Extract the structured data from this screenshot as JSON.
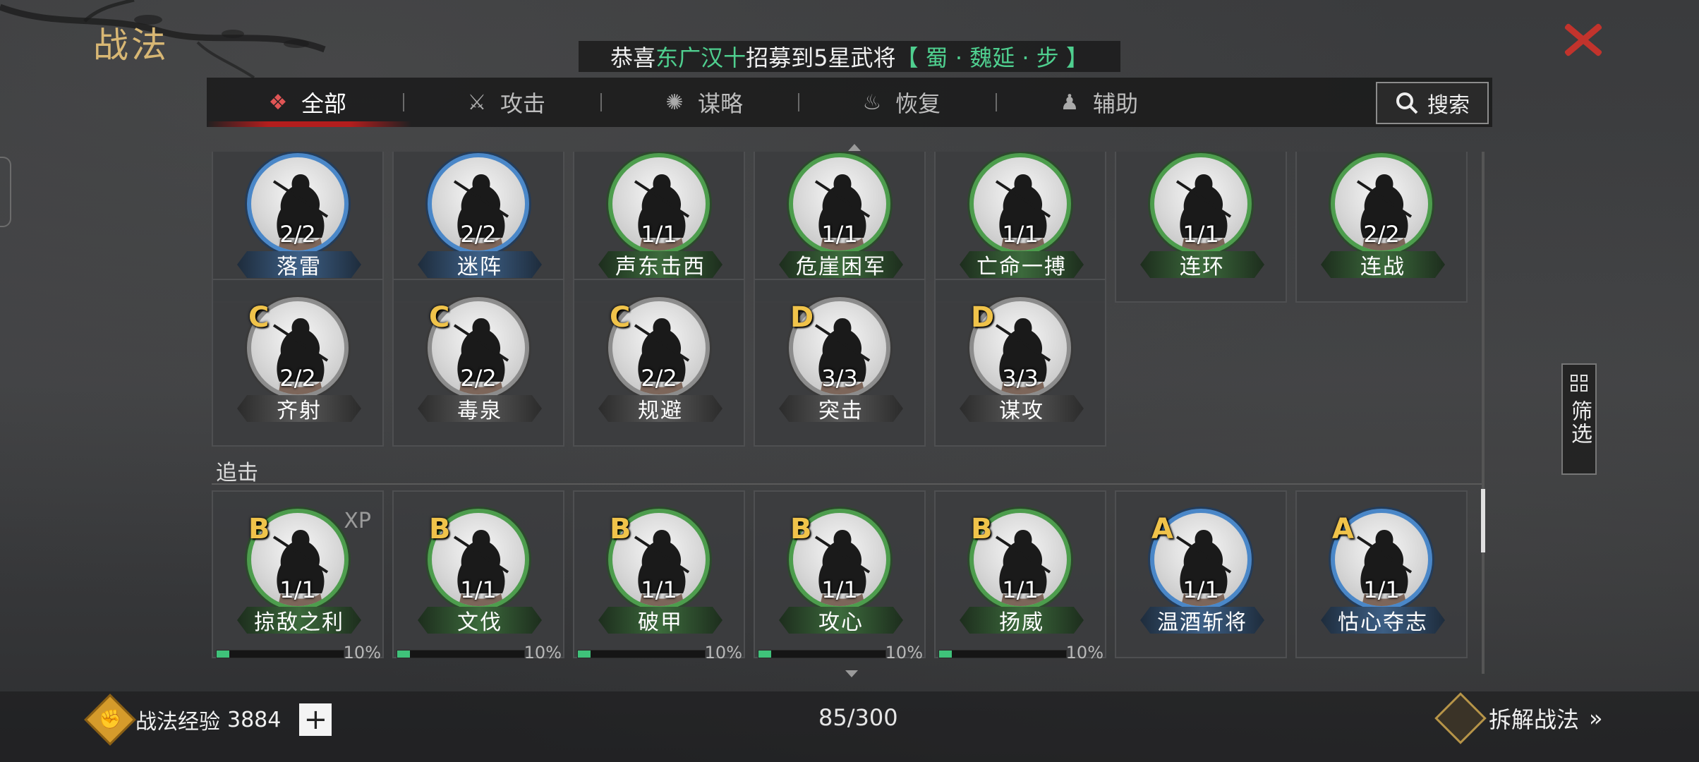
{
  "header": {
    "title": "战法",
    "close_icon": "close-x-icon"
  },
  "banner": {
    "prefix": "恭喜",
    "player": "东广汉十",
    "middle": "招募到5星武将",
    "general": "【 蜀 · 魏延 · 步 】"
  },
  "tabs": [
    {
      "label": "全部",
      "icon": "scroll-bundle-icon",
      "active": true
    },
    {
      "label": "攻击",
      "icon": "crossed-swords-icon",
      "active": false
    },
    {
      "label": "谋略",
      "icon": "fan-icon",
      "active": false
    },
    {
      "label": "恢复",
      "icon": "pot-icon",
      "active": false
    },
    {
      "label": "辅助",
      "icon": "pouch-icon",
      "active": false
    }
  ],
  "search": {
    "label": "搜索"
  },
  "rows": [
    {
      "cards": [
        {
          "grade": "",
          "count": "2/2",
          "name": "落雷",
          "color": "blue"
        },
        {
          "grade": "",
          "count": "2/2",
          "name": "迷阵",
          "color": "blue"
        },
        {
          "grade": "",
          "count": "1/1",
          "name": "声东击西",
          "color": "green"
        },
        {
          "grade": "",
          "count": "1/1",
          "name": "危崖困军",
          "color": "green"
        },
        {
          "grade": "",
          "count": "1/1",
          "name": "亡命一搏",
          "color": "green"
        },
        {
          "grade": "",
          "count": "1/1",
          "name": "连环",
          "color": "green"
        },
        {
          "grade": "",
          "count": "2/2",
          "name": "连战",
          "color": "green"
        }
      ]
    },
    {
      "cards": [
        {
          "grade": "C",
          "count": "2/2",
          "name": "齐射",
          "color": "gray"
        },
        {
          "grade": "C",
          "count": "2/2",
          "name": "毒泉",
          "color": "gray"
        },
        {
          "grade": "C",
          "count": "2/2",
          "name": "规避",
          "color": "gray"
        },
        {
          "grade": "D",
          "count": "3/3",
          "name": "突击",
          "color": "gray"
        },
        {
          "grade": "D",
          "count": "3/3",
          "name": "谋攻",
          "color": "gray"
        }
      ]
    }
  ],
  "section": {
    "label": "追击",
    "cards": [
      {
        "grade": "B",
        "count": "1/1",
        "name": "掠敌之利",
        "color": "green",
        "xp": "XP",
        "progress": 0.1,
        "pct": "10%"
      },
      {
        "grade": "B",
        "count": "1/1",
        "name": "文伐",
        "color": "green",
        "progress": 0.1,
        "pct": "10%"
      },
      {
        "grade": "B",
        "count": "1/1",
        "name": "破甲",
        "color": "green",
        "progress": 0.1,
        "pct": "10%"
      },
      {
        "grade": "B",
        "count": "1/1",
        "name": "攻心",
        "color": "green",
        "progress": 0.1,
        "pct": "10%"
      },
      {
        "grade": "B",
        "count": "1/1",
        "name": "扬威",
        "color": "green",
        "progress": 0.1,
        "pct": "10%"
      },
      {
        "grade": "A",
        "count": "1/1",
        "name": "温酒斩将",
        "color": "blue"
      },
      {
        "grade": "A",
        "count": "1/1",
        "name": "怙心夺志",
        "color": "blue"
      }
    ]
  },
  "filter": {
    "label": "筛选",
    "icon": "grid-filter-icon"
  },
  "footer": {
    "exp_label": "战法经验",
    "exp_value": "3884",
    "exp_icon": "fist-badge-icon",
    "plus": "+",
    "capacity": "85/300",
    "dismantle": "拆解战法",
    "dismantle_arrow": "»",
    "dismantle_icon": "scroll-diamond-icon"
  }
}
